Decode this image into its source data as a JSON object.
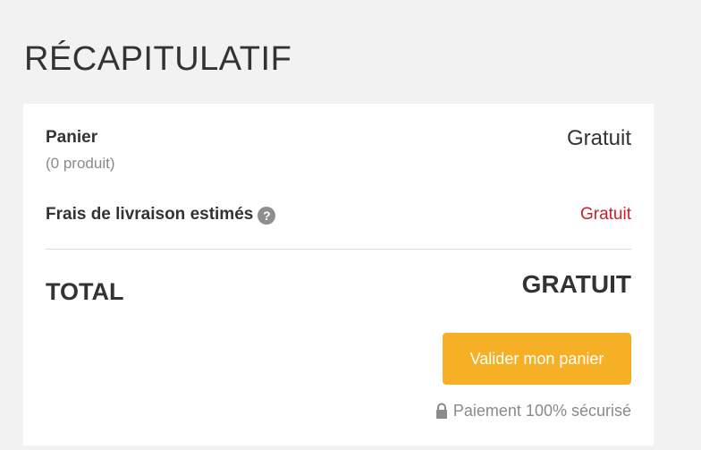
{
  "page": {
    "title": "RÉCAPITULATIF"
  },
  "summary": {
    "cart_label": "Panier",
    "cart_count": "(0 produit)",
    "cart_value": "Gratuit",
    "shipping_label": "Frais de livraison estimés",
    "shipping_help_icon": "help-icon",
    "shipping_help_glyph": "?",
    "shipping_value": "Gratuit",
    "total_label": "TOTAL",
    "total_value": "GRATUIT"
  },
  "actions": {
    "validate_label": "Valider mon panier"
  },
  "footer": {
    "secure_icon": "lock-icon",
    "secure_text": "Paiement 100% sécurisé"
  },
  "colors": {
    "background": "#f2f2f2",
    "card": "#ffffff",
    "accent_button": "#f5b026",
    "shipping_value": "#c8202f",
    "muted_text": "#8a8a8a"
  }
}
